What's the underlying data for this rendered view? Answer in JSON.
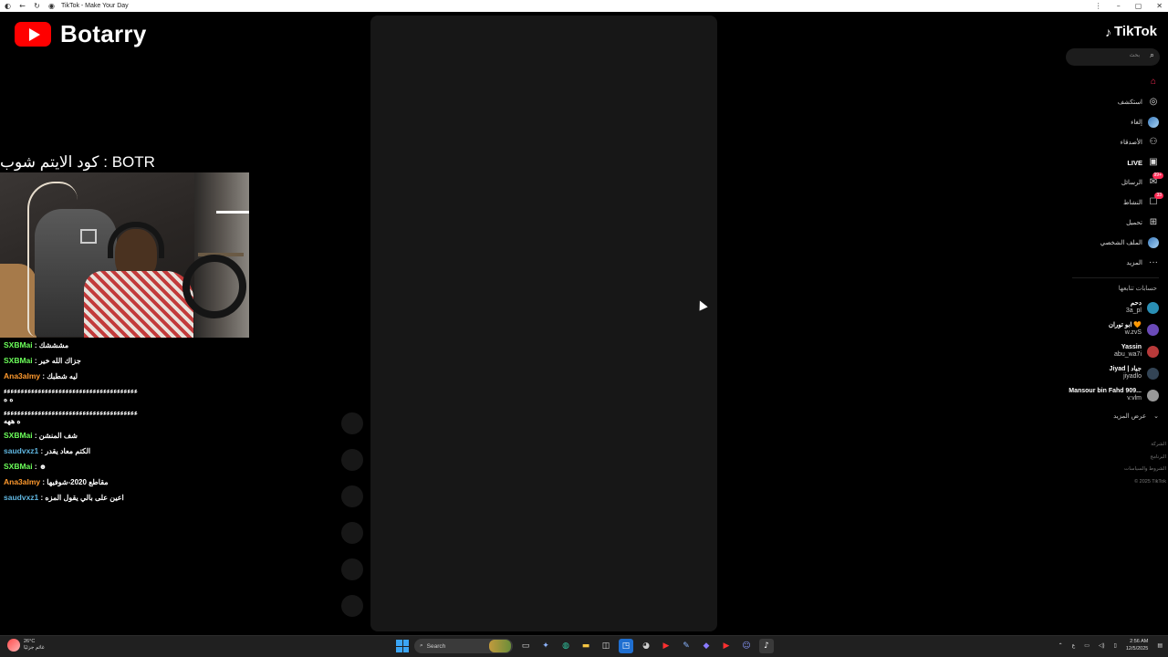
{
  "window": {
    "title": "TikTok - Make Your Day",
    "controls": {
      "menu": "⋮",
      "minimize": "–",
      "maximize": "▢",
      "close": "✕"
    }
  },
  "overlay": {
    "brand_name": "Botarry",
    "code_text": "كود الايتم شوب : BOTR",
    "chat": [
      {
        "user": "SXBMai",
        "msg": "مشششك",
        "color": "#6cff5a"
      },
      {
        "user": "SXBMai",
        "msg": "جزاك الله خير",
        "color": "#6cff5a"
      },
      {
        "user": "Ana3almy",
        "msg": "ليه شطبك",
        "color": "#ff9a2e"
      },
      {
        "user": "",
        "msg": "ءءءءءءءءءءءءءءءءءءءءءءءءءءءءءءءءءءءءءءءه ه",
        "color": "#ffffff",
        "wrap": true
      },
      {
        "user": "",
        "msg": "ءءءءءءءءءءءءءءءءءءءءءءءءءءءءءءءءءءءءءءءه ههه",
        "color": "#ffffff",
        "wrap": true
      },
      {
        "user": "SXBMai",
        "msg": "شف المنشن",
        "color": "#6cff5a"
      },
      {
        "user": "saudvxz1",
        "msg": "الكتم معاد يقدر",
        "color": "#5fb6e0"
      },
      {
        "user": "SXBMai",
        "msg": "☻",
        "color": "#6cff5a"
      },
      {
        "user": "Ana3almy",
        "msg": "مقاطع 2020-شوفيها",
        "color": "#ff9a2e"
      },
      {
        "user": "saudvxz1",
        "msg": "اعين على بالي يقول المزه",
        "color": "#5fb6e0"
      }
    ]
  },
  "tiktok": {
    "logo_text": "TikTok",
    "search_placeholder": "بحث",
    "nav": [
      {
        "label": "",
        "icon": "home-icon",
        "glyph": "⌂",
        "active": true
      },
      {
        "label": "استكشف",
        "icon": "compass-icon",
        "glyph": "◎"
      },
      {
        "label": "إلغاء",
        "icon": "avatar-icon",
        "glyph": ""
      },
      {
        "label": "الأصدقاء",
        "icon": "friends-icon",
        "glyph": "⚇"
      },
      {
        "label": "LIVE",
        "icon": "live-icon",
        "glyph": "▣",
        "live": true
      },
      {
        "label": "الرسائل",
        "icon": "messages-icon",
        "glyph": "✉",
        "badge": "99+"
      },
      {
        "label": "النشاط",
        "icon": "activity-icon",
        "glyph": "☐",
        "badge": "33"
      },
      {
        "label": "تحميل",
        "icon": "upload-icon",
        "glyph": "⊞"
      },
      {
        "label": "الملف الشخصي",
        "icon": "profile-icon",
        "glyph": ""
      },
      {
        "label": "المزيد",
        "icon": "more-icon",
        "glyph": "···"
      }
    ],
    "following_title": "حسابات تتابعها",
    "following": [
      {
        "name": "دحم",
        "handle": "3a_pl",
        "color": "#2a8fb5"
      },
      {
        "name": "ابو توران 🧡",
        "handle": "w.zvS",
        "color": "#6a4ab8"
      },
      {
        "name": "Yassin",
        "handle": "abu_wa7i",
        "color": "#b83a3a"
      },
      {
        "name": "Jiyad | جياد",
        "handle": "jiyadlo",
        "color": "#334455"
      },
      {
        "name": "Mansour bin Fahd 909...",
        "handle": "v.vlm",
        "color": "#999999"
      }
    ],
    "see_more": "عرض المزيد",
    "footer": [
      "الشركة",
      "البرنامج",
      "الشروط والسياسات",
      "© 2025 TikTok"
    ]
  },
  "taskbar": {
    "weather_temp": "26°C",
    "weather_desc": "غائم جزئيًا",
    "search_label": "Search",
    "time": "2:56 AM",
    "date": "12/5/2025",
    "lang": "ع"
  }
}
